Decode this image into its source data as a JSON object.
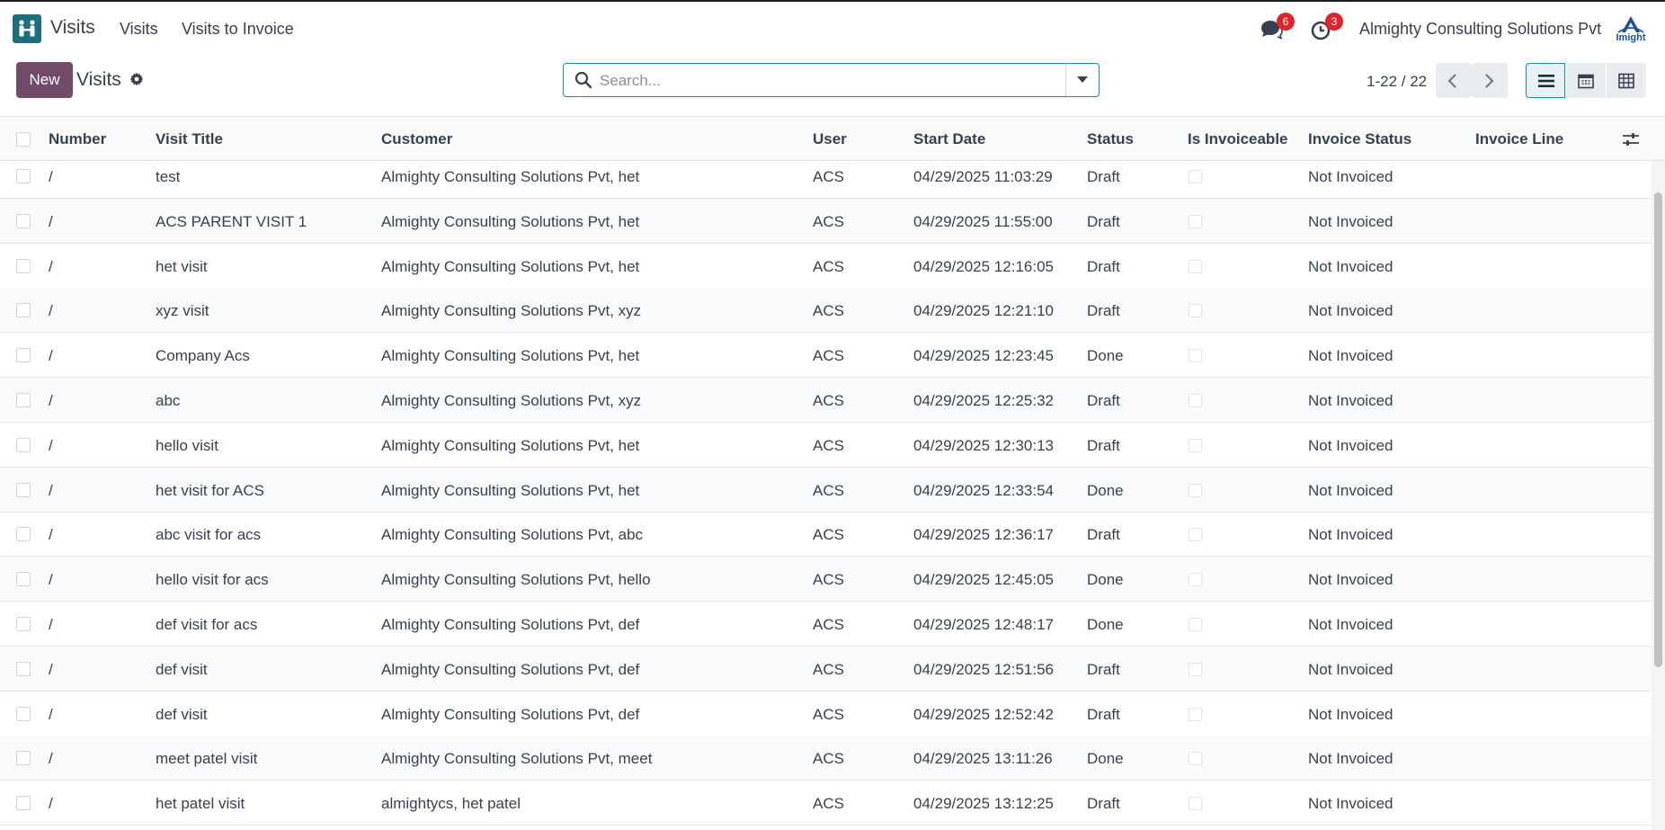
{
  "topbar": {
    "app_name": "Visits",
    "nav": [
      {
        "label": "Visits"
      },
      {
        "label": "Visits to Invoice"
      }
    ],
    "messages_count": "6",
    "activities_count": "3",
    "company": "Almighty Consulting Solutions Pvt",
    "logo_text": "Imight"
  },
  "control": {
    "new_label": "New",
    "title": "Visits",
    "search_placeholder": "Search...",
    "pager": "1-22 / 22"
  },
  "columns": [
    "Number",
    "Visit Title",
    "Customer",
    "User",
    "Start Date",
    "Status",
    "Is Invoiceable",
    "Invoice Status",
    "Invoice Line"
  ],
  "rows": [
    {
      "number": "/",
      "title": "test",
      "customer": "Almighty Consulting Solutions Pvt, het",
      "user": "ACS",
      "start": "04/29/2025 11:03:29",
      "status": "Draft",
      "invoice_status": "Not Invoiced"
    },
    {
      "number": "/",
      "title": "ACS PARENT VISIT 1",
      "customer": "Almighty Consulting Solutions Pvt, het",
      "user": "ACS",
      "start": "04/29/2025 11:55:00",
      "status": "Draft",
      "invoice_status": "Not Invoiced"
    },
    {
      "number": "/",
      "title": "het visit",
      "customer": "Almighty Consulting Solutions Pvt, het",
      "user": "ACS",
      "start": "04/29/2025 12:16:05",
      "status": "Draft",
      "invoice_status": "Not Invoiced"
    },
    {
      "number": "/",
      "title": "xyz visit",
      "customer": "Almighty Consulting Solutions Pvt, xyz",
      "user": "ACS",
      "start": "04/29/2025 12:21:10",
      "status": "Draft",
      "invoice_status": "Not Invoiced"
    },
    {
      "number": "/",
      "title": "Company Acs",
      "customer": "Almighty Consulting Solutions Pvt, het",
      "user": "ACS",
      "start": "04/29/2025 12:23:45",
      "status": "Done",
      "invoice_status": "Not Invoiced"
    },
    {
      "number": "/",
      "title": "abc",
      "customer": "Almighty Consulting Solutions Pvt, xyz",
      "user": "ACS",
      "start": "04/29/2025 12:25:32",
      "status": "Draft",
      "invoice_status": "Not Invoiced"
    },
    {
      "number": "/",
      "title": "hello visit",
      "customer": "Almighty Consulting Solutions Pvt, het",
      "user": "ACS",
      "start": "04/29/2025 12:30:13",
      "status": "Draft",
      "invoice_status": "Not Invoiced"
    },
    {
      "number": "/",
      "title": "het visit for ACS",
      "customer": "Almighty Consulting Solutions Pvt, het",
      "user": "ACS",
      "start": "04/29/2025 12:33:54",
      "status": "Done",
      "invoice_status": "Not Invoiced"
    },
    {
      "number": "/",
      "title": "abc visit for acs",
      "customer": "Almighty Consulting Solutions Pvt, abc",
      "user": "ACS",
      "start": "04/29/2025 12:36:17",
      "status": "Draft",
      "invoice_status": "Not Invoiced"
    },
    {
      "number": "/",
      "title": "hello visit for acs",
      "customer": "Almighty Consulting Solutions Pvt, hello",
      "user": "ACS",
      "start": "04/29/2025 12:45:05",
      "status": "Done",
      "invoice_status": "Not Invoiced"
    },
    {
      "number": "/",
      "title": "def visit for acs",
      "customer": "Almighty Consulting Solutions Pvt, def",
      "user": "ACS",
      "start": "04/29/2025 12:48:17",
      "status": "Done",
      "invoice_status": "Not Invoiced"
    },
    {
      "number": "/",
      "title": "def visit",
      "customer": "Almighty Consulting Solutions Pvt, def",
      "user": "ACS",
      "start": "04/29/2025 12:51:56",
      "status": "Draft",
      "invoice_status": "Not Invoiced"
    },
    {
      "number": "/",
      "title": "def visit",
      "customer": "Almighty Consulting Solutions Pvt, def",
      "user": "ACS",
      "start": "04/29/2025 12:52:42",
      "status": "Draft",
      "invoice_status": "Not Invoiced"
    },
    {
      "number": "/",
      "title": "meet patel visit",
      "customer": "Almighty Consulting Solutions Pvt, meet",
      "user": "ACS",
      "start": "04/29/2025 13:11:26",
      "status": "Done",
      "invoice_status": "Not Invoiced"
    },
    {
      "number": "/",
      "title": "het patel visit",
      "customer": "almightycs, het patel",
      "user": "ACS",
      "start": "04/29/2025 13:12:25",
      "status": "Draft",
      "invoice_status": "Not Invoiced"
    }
  ],
  "colors": {
    "brand": "#714b67",
    "accent": "#1d8b96",
    "badge": "#e0242b"
  },
  "icons": [
    "visits-app-icon",
    "chat-icon",
    "activity-clock-icon",
    "gear-icon",
    "search-icon",
    "caret-down-icon",
    "chevron-left-icon",
    "chevron-right-icon",
    "list-view-icon",
    "calendar-view-icon",
    "pivot-view-icon",
    "optional-columns-icon"
  ]
}
